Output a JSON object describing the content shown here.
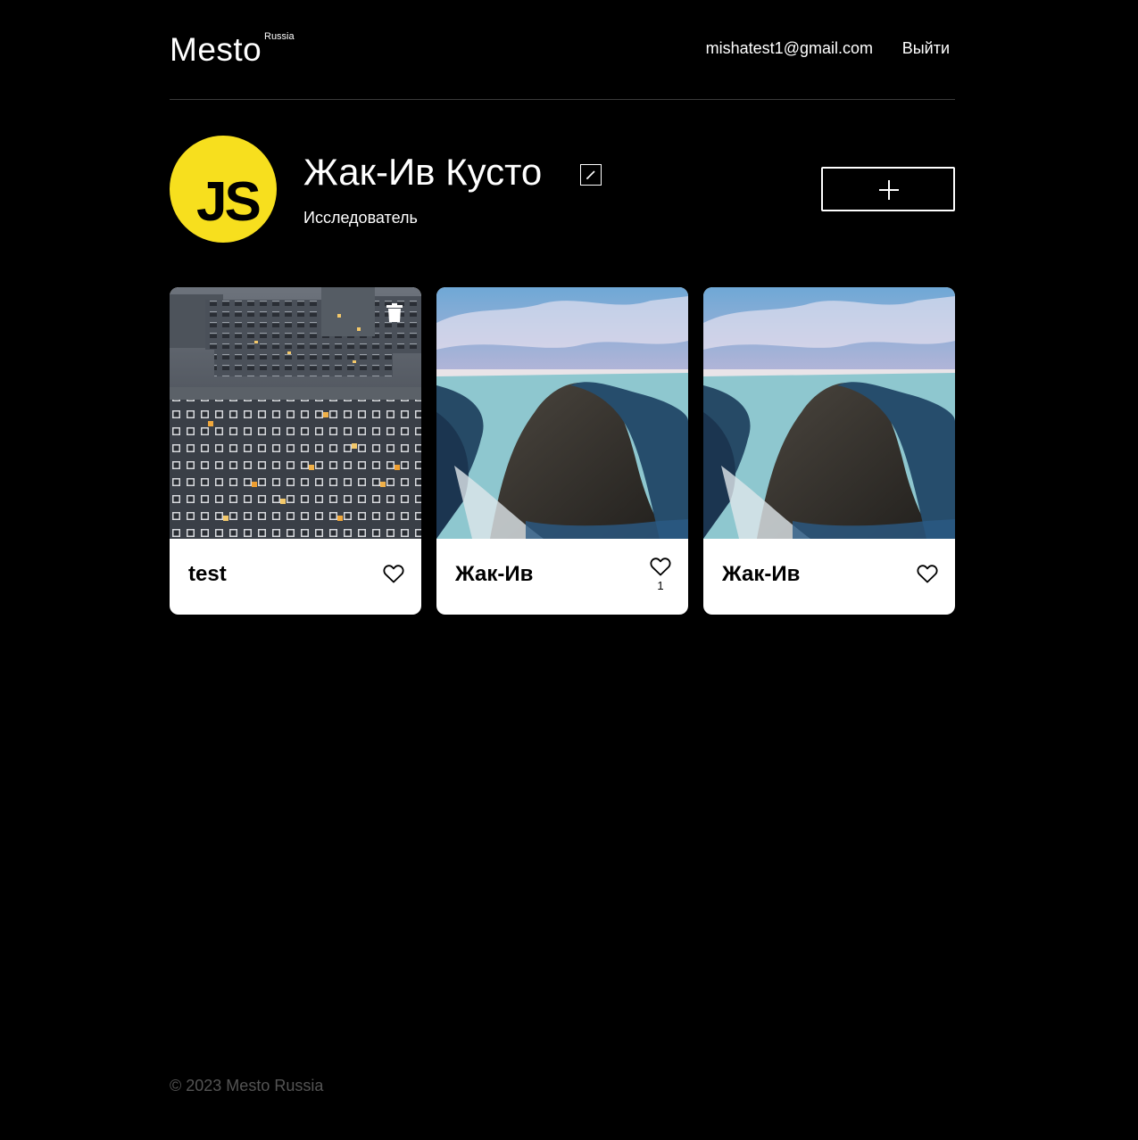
{
  "header": {
    "logo": "Mesto",
    "logo_sub": "Russia",
    "email": "mishatest1@gmail.com",
    "logout_label": "Выйти"
  },
  "profile": {
    "avatar_text": "JS",
    "name": "Жак-Ив Кусто",
    "about": "Исследователь",
    "edit_icon": "pencil-icon",
    "add_icon": "plus-icon"
  },
  "cards": [
    {
      "title": "test",
      "likes": "",
      "deletable": true,
      "image": "city-apartment-blocks-photo"
    },
    {
      "title": "Жак-Ив",
      "likes": "1",
      "deletable": false,
      "image": "snowy-cliff-photo"
    },
    {
      "title": "Жак-Ив",
      "likes": "",
      "deletable": false,
      "image": "snowy-cliff-photo"
    }
  ],
  "footer": {
    "copyright": "© 2023 Mesto Russia"
  },
  "colors": {
    "background": "#000000",
    "avatar_bg": "#f7df1e",
    "card_bg": "#ffffff",
    "footer_text": "#545454"
  }
}
